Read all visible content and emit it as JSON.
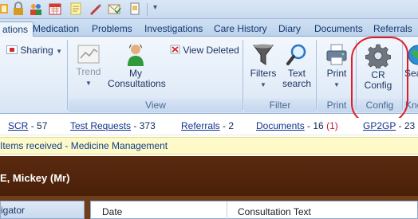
{
  "ribbon_tabs": [
    "ations",
    "Medication",
    "Problems",
    "Investigations",
    "Care History",
    "Diary",
    "Documents",
    "Referrals"
  ],
  "ribbon": {
    "sharing": "Sharing",
    "trend": "Trend",
    "my_consultations_line1": "My",
    "my_consultations_line2": "Consultations",
    "view_deleted": "View Deleted",
    "group_view": "View",
    "filters": "Filters",
    "text_search_line1": "Text",
    "text_search_line2": "search",
    "group_filter": "Filter",
    "print": "Print",
    "group_print": "Print",
    "cr_config_line1": "CR",
    "cr_config_line2": "Config",
    "group_config": "Config",
    "search_partial": "Sea",
    "knowledge_partial": "Knov"
  },
  "summary": {
    "scr_label": "SCR",
    "scr_count": "- 57",
    "test_requests_label": "Test Requests",
    "test_requests_count": "- 373",
    "referrals_label": "Referrals",
    "referrals_count": "- 2",
    "documents_label": "Documents",
    "documents_count": "- 16",
    "documents_alert": "(1)",
    "gp2gp_label": "GP2GP",
    "gp2gp_count": "- 23"
  },
  "notification": "Items received - Medicine Management",
  "patient": {
    "name": "E, Mickey (Mr)"
  },
  "navigator": {
    "label": "igator"
  },
  "grid": {
    "col_date": "Date",
    "col_text": "Consultation Text"
  },
  "colors": {
    "highlight": "#e31b23",
    "banner": "#4a2008",
    "notification_bg": "#fdf9c9",
    "alert": "#c8102e"
  }
}
